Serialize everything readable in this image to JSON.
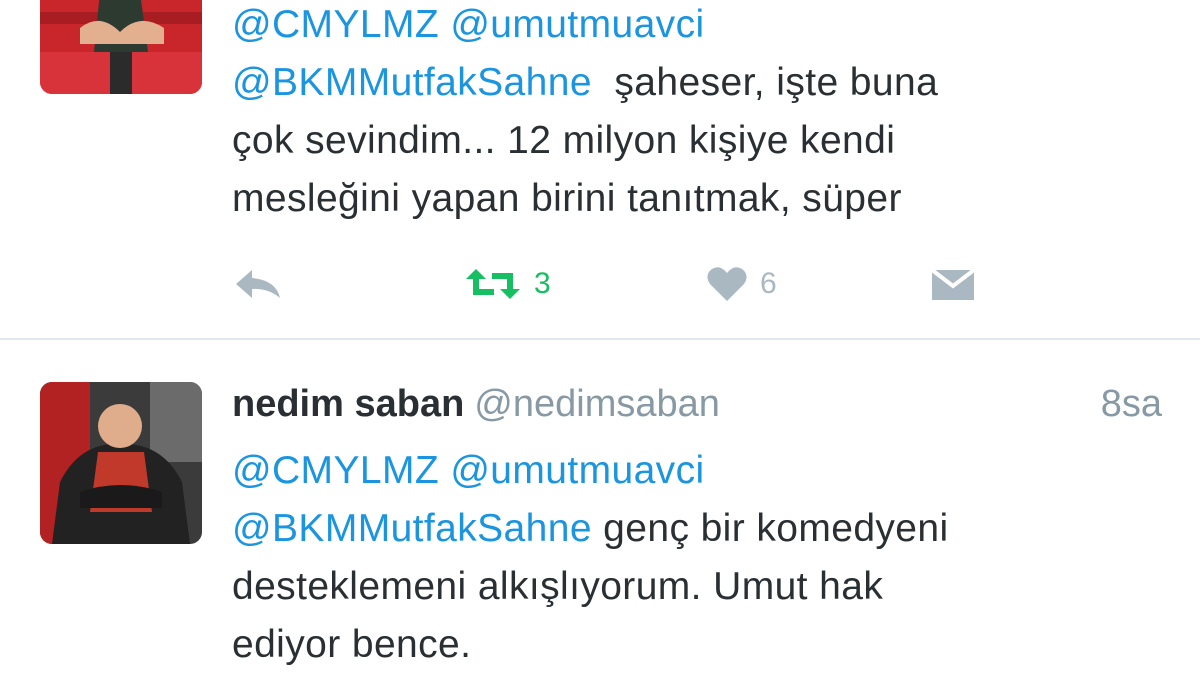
{
  "tweets": [
    {
      "mentions": [
        "@CMYLMZ",
        "@umutmuavci",
        "@BKMMutfakSahne"
      ],
      "text_line1_after": "şaheser, işte buna",
      "text_line2": "çok sevindim... 12 milyon kişiye kendi",
      "text_line3": "mesleğini yapan birini tanıtmak, süper",
      "retweet_count": "3",
      "like_count": "6"
    },
    {
      "name": "nedim saban",
      "handle": "@nedimsaban",
      "time": "8sa",
      "mentions": [
        "@CMYLMZ",
        "@umutmuavci",
        "@BKMMutfakSahne"
      ],
      "text_line2_after": "genç bir komedyeni",
      "text_line3": "desteklemeni alkışlıyorum. Umut hak",
      "text_line4": "ediyor bence."
    }
  ],
  "icons": {
    "reply": "reply-icon",
    "retweet": "retweet-icon",
    "like": "heart-icon",
    "message": "envelope-icon"
  },
  "colors": {
    "mention": "#1b95e0",
    "retweet_active": "#17bf63",
    "muted": "#8899a6",
    "text": "#292f33"
  }
}
